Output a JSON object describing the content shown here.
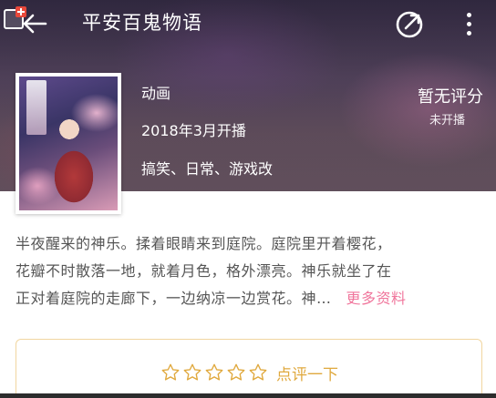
{
  "header": {
    "title": "平安百鬼物语",
    "back_icon": "back-arrow-icon",
    "share_icon": "share-icon",
    "more_icon": "more-vertical-icon"
  },
  "info": {
    "type": "动画",
    "air_date": "2018年3月开播",
    "tags": "搞笑、日常、游戏改"
  },
  "rating": {
    "value": "暂无评分",
    "status": "未开播"
  },
  "description": {
    "line1": "半夜醒来的神乐。揉着眼睛来到庭院。庭院里开着樱花，",
    "line2": "花瓣不时散落一地，就着月色，格外漂亮。神乐就坐了在",
    "line3": "正对着庭院的走廊下，一边纳凉一边赏花。神…",
    "more_label": "更多资料"
  },
  "review": {
    "label": "点评一下",
    "stars": 5
  },
  "colors": {
    "accent_pink": "#f0769c",
    "review_gold": "#e0a93e",
    "review_border": "#f1d6a0",
    "text_gray": "#555555"
  }
}
